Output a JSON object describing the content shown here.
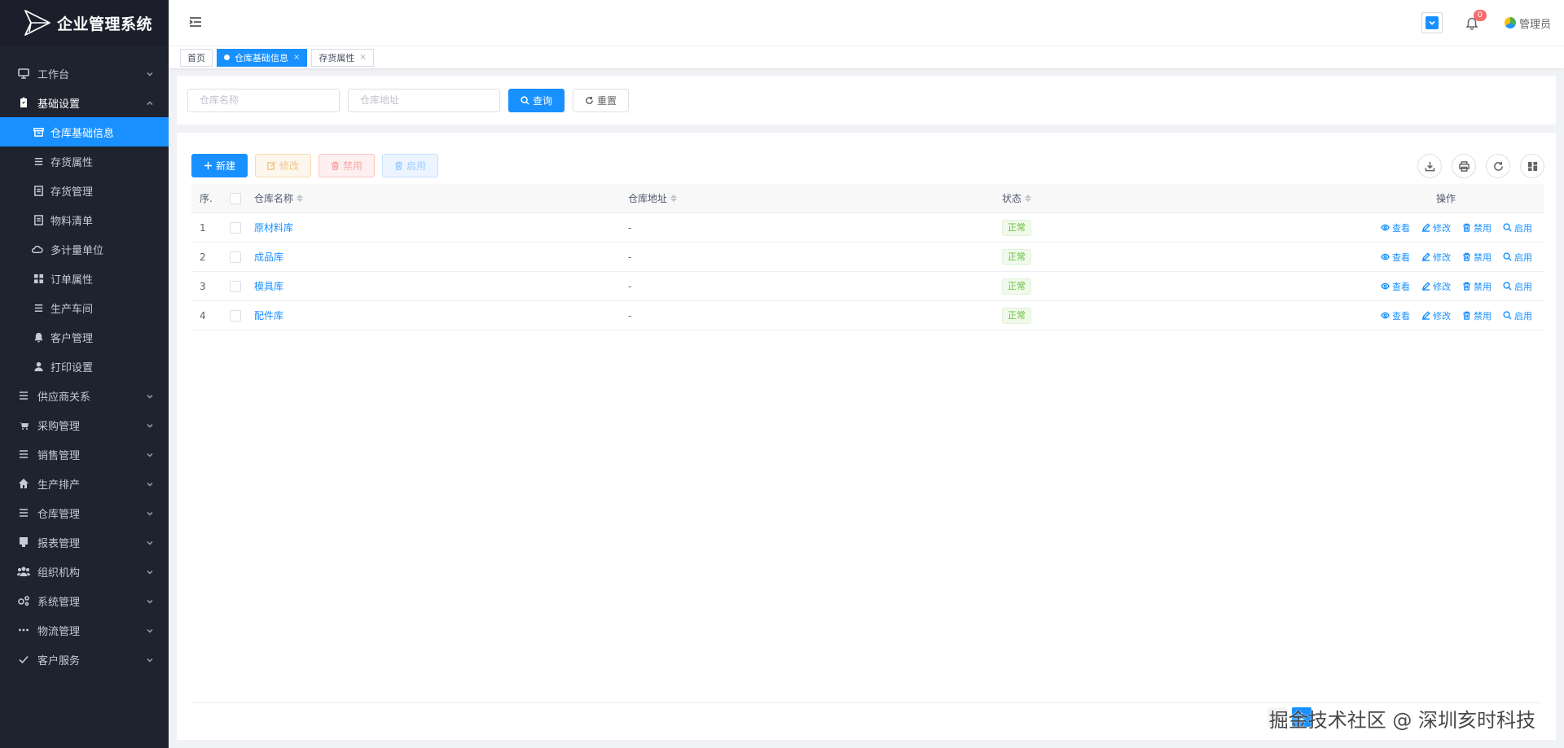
{
  "app": {
    "title": "企业管理系统"
  },
  "sidebar": {
    "groups": [
      {
        "label": "工作台",
        "icon": "monitor-icon",
        "open": false
      },
      {
        "label": "基础设置",
        "icon": "clipboard-icon",
        "open": true,
        "children": [
          {
            "label": "仓库基础信息",
            "icon": "archive-icon",
            "active": true
          },
          {
            "label": "存货属性",
            "icon": "list-icon"
          },
          {
            "label": "存货管理",
            "icon": "document-icon"
          },
          {
            "label": "物料清单",
            "icon": "document-icon"
          },
          {
            "label": "多计量单位",
            "icon": "cloud-icon"
          },
          {
            "label": "订单属性",
            "icon": "grid-icon"
          },
          {
            "label": "生产车间",
            "icon": "list-icon"
          },
          {
            "label": "客户管理",
            "icon": "bell-icon"
          },
          {
            "label": "打印设置",
            "icon": "user-icon"
          }
        ]
      },
      {
        "label": "供应商关系",
        "icon": "list-icon"
      },
      {
        "label": "采购管理",
        "icon": "cart-icon"
      },
      {
        "label": "销售管理",
        "icon": "list-icon"
      },
      {
        "label": "生产排产",
        "icon": "home-icon"
      },
      {
        "label": "仓库管理",
        "icon": "list-icon"
      },
      {
        "label": "报表管理",
        "icon": "report-icon"
      },
      {
        "label": "组织机构",
        "icon": "users-icon"
      },
      {
        "label": "系统管理",
        "icon": "gears-icon"
      },
      {
        "label": "物流管理",
        "icon": "dots-icon"
      },
      {
        "label": "客户服务",
        "icon": "check-icon"
      }
    ]
  },
  "header": {
    "notification_count": "0",
    "user_name": "管理员"
  },
  "tags": [
    {
      "label": "首页",
      "active": false,
      "closable": false
    },
    {
      "label": "仓库基础信息",
      "active": true,
      "closable": true,
      "close_glyph": "×"
    },
    {
      "label": "存货属性",
      "active": false,
      "closable": true,
      "close_glyph": "×"
    }
  ],
  "search": {
    "name_placeholder": "仓库名称",
    "address_placeholder": "仓库地址",
    "query_label": "查询",
    "reset_label": "重置"
  },
  "toolbar": {
    "new_label": "新建",
    "edit_label": "修改",
    "disable_label": "禁用",
    "enable_label": "启用"
  },
  "table": {
    "headers": {
      "index": "序.",
      "name": "仓库名称",
      "address": "仓库地址",
      "status": "状态",
      "ops": "操作"
    },
    "op_labels": {
      "view": "查看",
      "edit": "修改",
      "disable": "禁用",
      "enable": "启用"
    },
    "rows": [
      {
        "index": "1",
        "name": "原材料库",
        "address": "-",
        "status": "正常"
      },
      {
        "index": "2",
        "name": "成品库",
        "address": "-",
        "status": "正常"
      },
      {
        "index": "3",
        "name": "模具库",
        "address": "-",
        "status": "正常"
      },
      {
        "index": "4",
        "name": "配件库",
        "address": "-",
        "status": "正常"
      }
    ]
  },
  "pager": {
    "current": "1"
  },
  "watermark": "掘金技术社区 @ 深圳亥时科技",
  "colors": {
    "primary": "#1890ff",
    "sidebar_bg": "#1f2330",
    "success": "#67c23a",
    "danger": "#f56c6c"
  }
}
